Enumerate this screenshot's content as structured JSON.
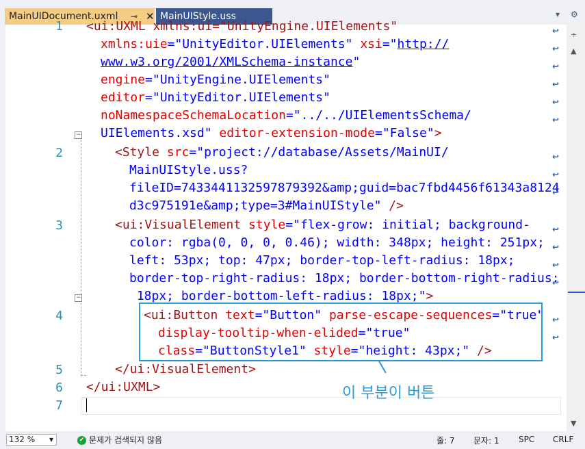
{
  "tabs": [
    {
      "label": "MainUIDocument.uxml",
      "active": true
    },
    {
      "label": "MainUIStyle.uss",
      "active": false
    }
  ],
  "line_numbers": [
    "1",
    "2",
    "3",
    "4",
    "5",
    "6",
    "7"
  ],
  "code": {
    "l1a": "<ui:UXML xmlns:ui=\"UnityEngine.UIElements\"",
    "l1b_attr": "xmlns:uie",
    "l1b_val": "=\"UnityEditor.UIElements\"",
    "l1b_attr2": " xsi",
    "l1b_eq": "=\"",
    "l1b_link": "http://",
    "l1c_link": "www.w3.org/2001/XMLSchema-instance",
    "l1c_end": "\"",
    "l1d_attr": "engine",
    "l1d_val": "=\"UnityEngine.UIElements\"",
    "l1e_attr": "editor",
    "l1e_val": "=\"UnityEditor.UIElements\"",
    "l1f_attr": "noNamespaceSchemaLocation",
    "l1f_val": "=\"../../UIElementsSchema/",
    "l1g_val": "UIElements.xsd\"",
    "l1g_attr": " editor-extension-mode",
    "l1g_val2": "=\"False\"",
    "l1g_end": ">",
    "l2a_tag": "<Style",
    "l2a_attr": " src",
    "l2a_val": "=\"project://database/Assets/MainUI/",
    "l2b": "MainUIStyle.uss?",
    "l2c": "fileID=7433441132597879392&amp;guid=bac7fbd4456f61343a8124",
    "l2d": "d3c975191e&amp;type=3#MainUIStyle\"",
    "l2d_end": " />",
    "l3a_tag": "<ui:VisualElement",
    "l3a_attr": " style",
    "l3a_val": "=\"flex-grow: initial; background-",
    "l3b": "color: rgba(0, 0, 0, 0.46); width: 348px; height: 251px;",
    "l3c": "left: 53px; top: 47px; border-top-left-radius: 18px;",
    "l3d": "border-top-right-radius: 18px; border-bottom-right-radius:",
    "l3e": " 18px; border-bottom-left-radius: 18px;\"",
    "l3e_end": ">",
    "l4a_tag": "<ui:Button",
    "l4a_attr": " text",
    "l4a_val": "=\"Button\"",
    "l4a_attr2": " parse-escape-sequences",
    "l4a_val2": "=\"true\"",
    "l4b_attr": "display-tooltip-when-elided",
    "l4b_val": "=\"true\"",
    "l4c_attr": "class",
    "l4c_val": "=\"ButtonStyle1\"",
    "l4c_attr2": " style",
    "l4c_val2": "=\"height: 43px;\"",
    "l4c_end": " />",
    "l5": "</ui:VisualElement>",
    "l6": "</ui:UXML>"
  },
  "annotation": "이 부분이 버튼",
  "status": {
    "zoom": "132 %",
    "issues": "문제가 검색되지 않음",
    "line": "줄: 7",
    "char": "문자: 1",
    "spc": "SPC",
    "eol": "CRLF"
  },
  "colors": {
    "active_tab": "#f5cc84",
    "inactive_tab": "#3c5690",
    "line_number": "#2b91af",
    "attribute": "#e50000",
    "value": "#0000ff",
    "callout": "#2a9bd6"
  }
}
